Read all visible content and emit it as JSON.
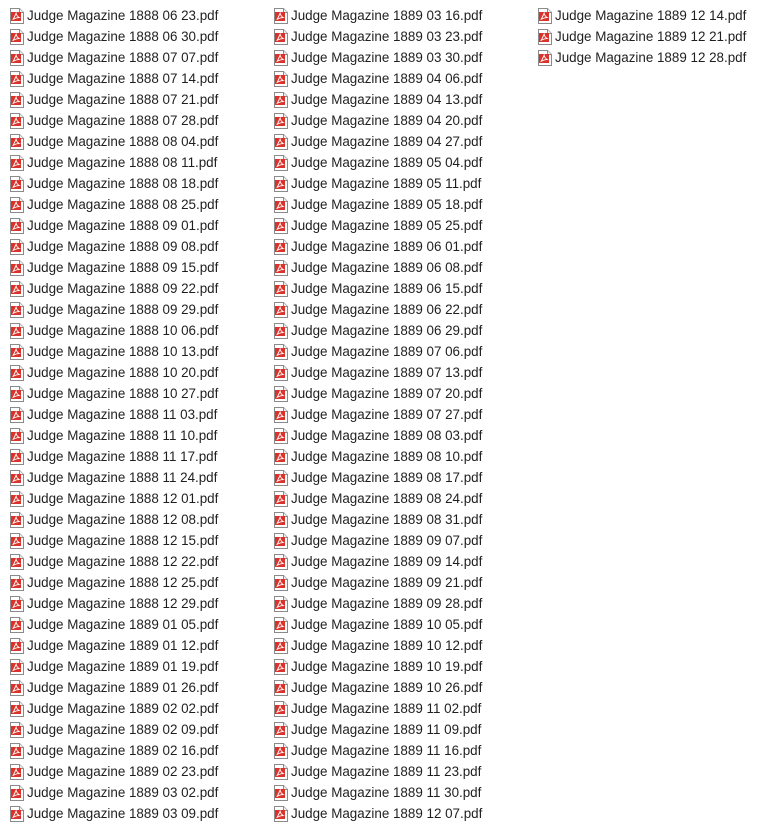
{
  "view": {
    "columns": [
      [
        "Judge Magazine 1888 06 23.pdf",
        "Judge Magazine 1888 06 30.pdf",
        "Judge Magazine 1888 07 07.pdf",
        "Judge Magazine 1888 07 14.pdf",
        "Judge Magazine 1888 07 21.pdf",
        "Judge Magazine 1888 07 28.pdf",
        "Judge Magazine 1888 08 04.pdf",
        "Judge Magazine 1888 08 11.pdf",
        "Judge Magazine 1888 08 18.pdf",
        "Judge Magazine 1888 08 25.pdf",
        "Judge Magazine 1888 09 01.pdf",
        "Judge Magazine 1888 09 08.pdf",
        "Judge Magazine 1888 09 15.pdf",
        "Judge Magazine 1888 09 22.pdf",
        "Judge Magazine 1888 09 29.pdf",
        "Judge Magazine 1888 10 06.pdf",
        "Judge Magazine 1888 10 13.pdf",
        "Judge Magazine 1888 10 20.pdf",
        "Judge Magazine 1888 10 27.pdf",
        "Judge Magazine 1888 11 03.pdf",
        "Judge Magazine 1888 11 10.pdf",
        "Judge Magazine 1888 11 17.pdf",
        "Judge Magazine 1888 11 24.pdf",
        "Judge Magazine 1888 12 01.pdf",
        "Judge Magazine 1888 12 08.pdf",
        "Judge Magazine 1888 12 15.pdf",
        "Judge Magazine 1888 12 22.pdf",
        "Judge Magazine 1888 12 25.pdf",
        "Judge Magazine 1888 12 29.pdf",
        "Judge Magazine 1889 01 05.pdf",
        "Judge Magazine 1889 01 12.pdf",
        "Judge Magazine 1889 01 19.pdf",
        "Judge Magazine 1889 01 26.pdf",
        "Judge Magazine 1889 02 02.pdf",
        "Judge Magazine 1889 02 09.pdf",
        "Judge Magazine 1889 02 16.pdf",
        "Judge Magazine 1889 02 23.pdf",
        "Judge Magazine 1889 03 02.pdf",
        "Judge Magazine 1889 03 09.pdf"
      ],
      [
        "Judge Magazine 1889 03 16.pdf",
        "Judge Magazine 1889 03 23.pdf",
        "Judge Magazine 1889 03 30.pdf",
        "Judge Magazine 1889 04 06.pdf",
        "Judge Magazine 1889 04 13.pdf",
        "Judge Magazine 1889 04 20.pdf",
        "Judge Magazine 1889 04 27.pdf",
        "Judge Magazine 1889 05 04.pdf",
        "Judge Magazine 1889 05 11.pdf",
        "Judge Magazine 1889 05 18.pdf",
        "Judge Magazine 1889 05 25.pdf",
        "Judge Magazine 1889 06 01.pdf",
        "Judge Magazine 1889 06 08.pdf",
        "Judge Magazine 1889 06 15.pdf",
        "Judge Magazine 1889 06 22.pdf",
        "Judge Magazine 1889 06 29.pdf",
        "Judge Magazine 1889 07 06.pdf",
        "Judge Magazine 1889 07 13.pdf",
        "Judge Magazine 1889 07 20.pdf",
        "Judge Magazine 1889 07 27.pdf",
        "Judge Magazine 1889 08 03.pdf",
        "Judge Magazine 1889 08 10.pdf",
        "Judge Magazine 1889 08 17.pdf",
        "Judge Magazine 1889 08 24.pdf",
        "Judge Magazine 1889 08 31.pdf",
        "Judge Magazine 1889 09 07.pdf",
        "Judge Magazine 1889 09 14.pdf",
        "Judge Magazine 1889 09 21.pdf",
        "Judge Magazine 1889 09 28.pdf",
        "Judge Magazine 1889 10 05.pdf",
        "Judge Magazine 1889 10 12.pdf",
        "Judge Magazine 1889 10 19.pdf",
        "Judge Magazine 1889 10 26.pdf",
        "Judge Magazine 1889 11 02.pdf",
        "Judge Magazine 1889 11 09.pdf",
        "Judge Magazine 1889 11 16.pdf",
        "Judge Magazine 1889 11 23.pdf",
        "Judge Magazine 1889 11 30.pdf",
        "Judge Magazine 1889 12 07.pdf"
      ],
      [
        "Judge Magazine 1889 12 14.pdf",
        "Judge Magazine 1889 12 21.pdf",
        "Judge Magazine 1889 12 28.pdf"
      ]
    ],
    "icon": "pdf-file-icon",
    "colors": {
      "text": "#1f1f1f",
      "icon_red": "#d9332b",
      "background": "#ffffff"
    }
  }
}
